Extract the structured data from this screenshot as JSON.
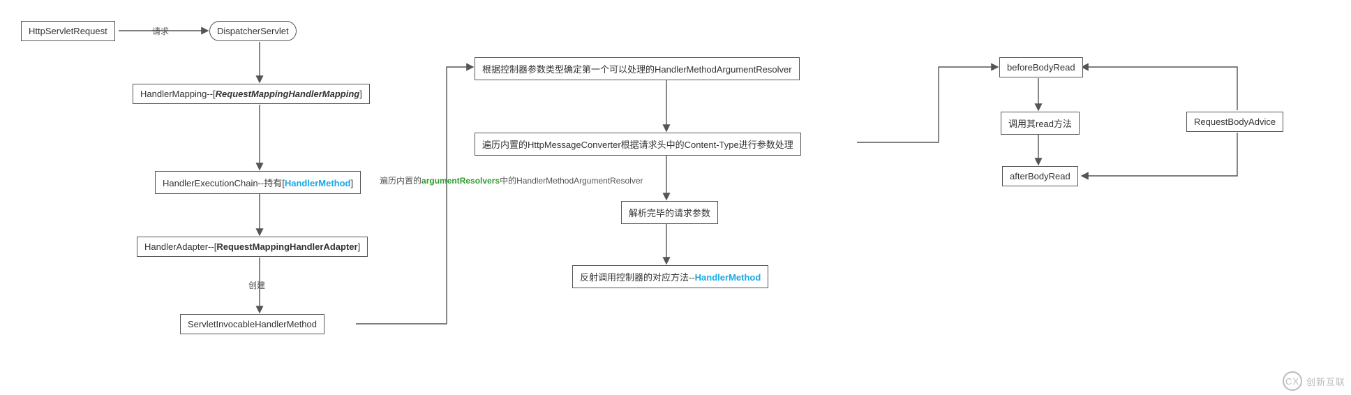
{
  "nodes": {
    "httpServletRequest": "HttpServletRequest",
    "dispatcherServlet": "DispatcherServlet",
    "handlerMapping_pre": "HandlerMapping--[",
    "handlerMapping_em": "RequestMappingHandlerMapping",
    "handlerMapping_post": "]",
    "handlerExecChain_pre": "HandlerExecutionChain--持有[",
    "handlerExecChain_em": "HandlerMethod",
    "handlerExecChain_post": "]",
    "handlerAdapter_pre": "HandlerAdapter--[",
    "handlerAdapter_em": "RequestMappingHandlerAdapter",
    "handlerAdapter_post": "]",
    "servletInvocable": "ServletInvocableHandlerMethod",
    "argResolver": "根据控制器参数类型确定第一个可以处理的HandlerMethodArgumentResolver",
    "msgConverter": "遍历内置的HttpMessageConverter根据请求头中的Content-Type进行参数处理",
    "parsedParams": "解析完毕的请求参数",
    "invoke_pre": "反射调用控制器的对应方法--",
    "invoke_em": "HandlerMethod",
    "beforeBodyRead": "beforeBodyRead",
    "callRead": "调用其read方法",
    "afterBodyRead": "afterBodyRead",
    "requestBodyAdvice": "RequestBodyAdvice"
  },
  "labels": {
    "request": "请求",
    "create": "创建",
    "argResolvers_pre": "遍历内置的",
    "argResolvers_em": "argumentResolvers",
    "argResolvers_post": "中的HandlerMethodArgumentResolver"
  },
  "watermark": {
    "text": "创新互联",
    "logo": "CX"
  }
}
